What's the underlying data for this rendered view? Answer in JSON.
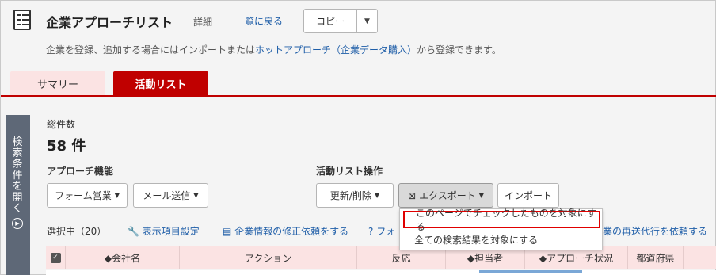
{
  "header": {
    "title": "企業アプローチリスト",
    "title_sub": "詳細",
    "back_link": "一覧に戻る",
    "copy_label": "コピー",
    "copy_caret": "▼",
    "description_pre": "企業を登録、追加する場合にはインポートまたは",
    "description_link": "ホットアプローチ（企業データ購入）",
    "description_post": "から登録できます。"
  },
  "tabs": [
    {
      "label": "サマリー",
      "active": false
    },
    {
      "label": "活動リスト",
      "active": true
    }
  ],
  "side_panel": {
    "label": "検索条件を開く",
    "icon": "chevron-right-circle-icon",
    "icon_glyph": "▶"
  },
  "summary": {
    "count_label": "総件数",
    "count_value": "58 件"
  },
  "approach": {
    "label": "アプローチ機能",
    "buttons": [
      "フォーム営業",
      "メール送信"
    ]
  },
  "activity_ops": {
    "label": "活動リスト操作",
    "update_delete": "更新/削除",
    "export": "エクスポート",
    "import": "インポート",
    "caret": "▼",
    "export_icon_glyph": "⊠"
  },
  "selection_row": {
    "selected": "選択中（20）",
    "display_settings": "表示項目設定",
    "correction_request": "企業情報の修正依頼をする",
    "form_partial": "フォ",
    "resend_partial": "業の再送代行を依頼する"
  },
  "table_headers": {
    "check_glyph": "✓",
    "company": "◆会社名",
    "action": "アクション",
    "reaction": "反応",
    "owner": "◆担当者",
    "approach_status": "◆アプローチ状況",
    "prefecture": "都道府県"
  },
  "export_dropdown": {
    "items": [
      "このページでチェックしたものを対象にする",
      "全ての検索結果を対象にする"
    ]
  },
  "colors": {
    "accent": "#c00000",
    "link": "#1f5ea8",
    "tab_inactive": "#fbe3e3",
    "side_panel": "#5e6877",
    "highlight_box": "#e00000"
  }
}
